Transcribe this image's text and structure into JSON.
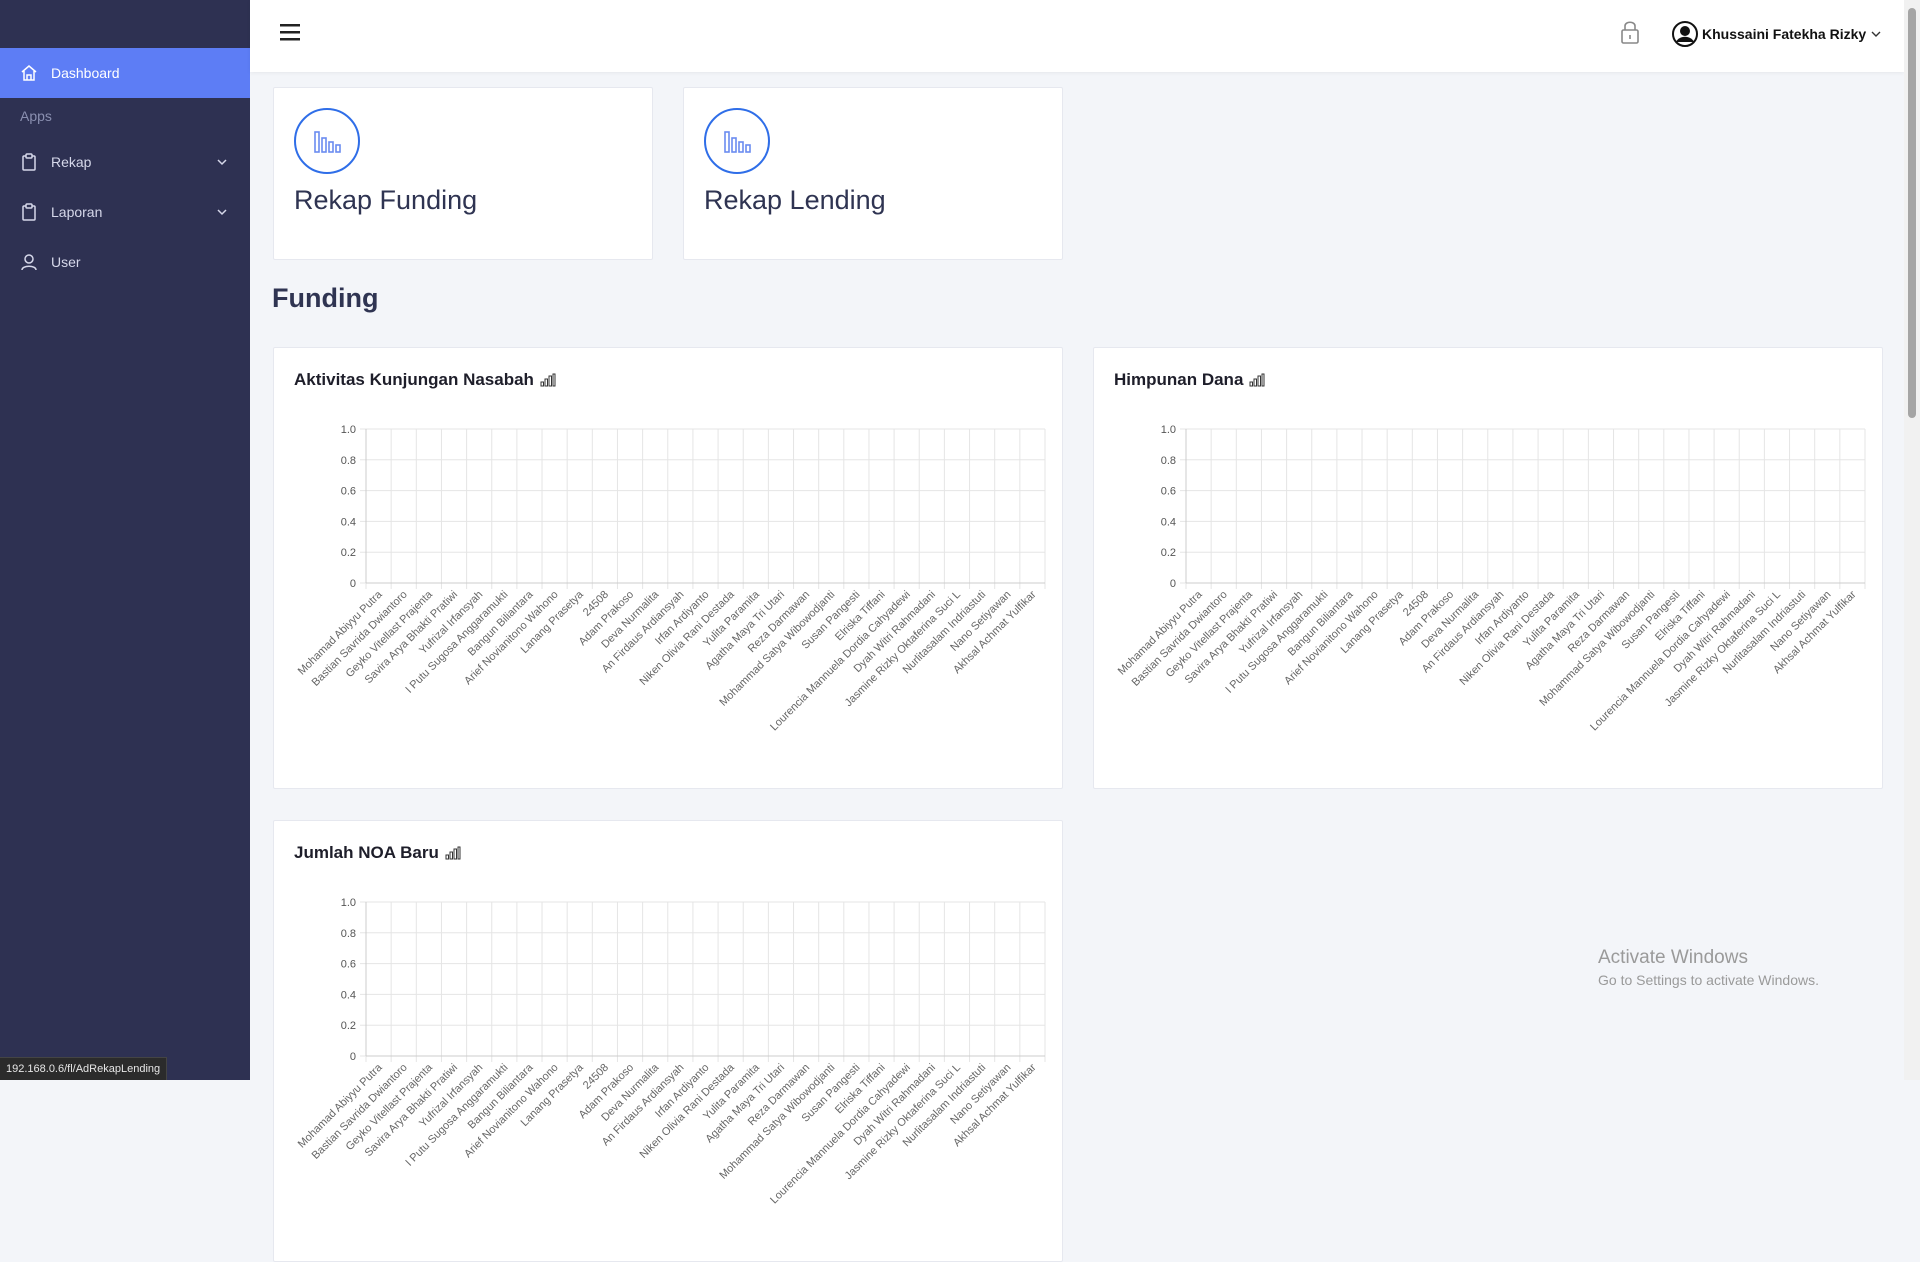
{
  "sidebar": {
    "dashboard_label": "Dashboard",
    "section_label": "Apps",
    "items": [
      {
        "label": "Rekap",
        "icon": "clipboard-icon",
        "expandable": true
      },
      {
        "label": "Laporan",
        "icon": "clipboard-icon",
        "expandable": true
      },
      {
        "label": "User",
        "icon": "user-icon",
        "expandable": false
      }
    ],
    "colors": {
      "background": "#2e3152",
      "active": "#5d7df5"
    }
  },
  "status_url": "192.168.0.6/fl/AdRekapLending",
  "topbar": {
    "user_name": "Khussaini Fatekha Rizky"
  },
  "summary_cards": [
    {
      "title": "Rekap Funding",
      "icon": "bar-chart-icon"
    },
    {
      "title": "Rekap Lending",
      "icon": "bar-chart-icon"
    }
  ],
  "section_heading": "Funding",
  "names": [
    "Mohamad Abiyyu Putra",
    "Bastian Savrida Dwiantoro",
    "Geyko Vitellast Prajenta",
    "Savira Arya Bhakti Pratiwi",
    "Yufrizal Irfansyah",
    "I Putu Sugosa Anggaramukti",
    "Bangun Biliantara",
    "Arief Novianitono Wahono",
    "Lanang Prasetya",
    "24508",
    "Adam Prakoso",
    "Deva Nurmalita",
    "An Firdaus Ardiansyah",
    "Irfan Ardiyanto",
    "Niken Olivia Rani Destada",
    "Yulita Paramita",
    "Agatha Maya Tri Utari",
    "Reza Darmawan",
    "Mohammad Satya Wibowodjanti",
    "Susan Pangesti",
    "Elriska Tiffani",
    "Lourencia Mannuela Dordia Cahyadewi",
    "Dyah Witri Rahmadani",
    "Jasmine Rizky Oktaferina Suci L",
    "Nurlitasalam Indriastuti",
    "Nano Setiyawan",
    "Akhsal Achmat Yulfikar"
  ],
  "chart_data": [
    {
      "type": "bar",
      "title": "Aktivitas Kunjungan Nasabah",
      "categories_ref": "names",
      "values": [
        0,
        0,
        0,
        0,
        0,
        0,
        0,
        0,
        0,
        0,
        0,
        0,
        0,
        0,
        0,
        0,
        0,
        0,
        0,
        0,
        0,
        0,
        0,
        0,
        0,
        0,
        0
      ],
      "yticks": [
        "1.0",
        "0.8",
        "0.6",
        "0.4",
        "0.2",
        "0"
      ],
      "ylim": [
        0,
        1
      ],
      "grid": true
    },
    {
      "type": "bar",
      "title": "Himpunan Dana",
      "categories_ref": "names",
      "values": [
        0,
        0,
        0,
        0,
        0,
        0,
        0,
        0,
        0,
        0,
        0,
        0,
        0,
        0,
        0,
        0,
        0,
        0,
        0,
        0,
        0,
        0,
        0,
        0,
        0,
        0,
        0
      ],
      "yticks": [
        "1.0",
        "0.8",
        "0.6",
        "0.4",
        "0.2",
        "0"
      ],
      "ylim": [
        0,
        1
      ],
      "grid": true
    },
    {
      "type": "bar",
      "title": "Jumlah NOA Baru",
      "categories_ref": "names",
      "values": [
        0,
        0,
        0,
        0,
        0,
        0,
        0,
        0,
        0,
        0,
        0,
        0,
        0,
        0,
        0,
        0,
        0,
        0,
        0,
        0,
        0,
        0,
        0,
        0,
        0,
        0,
        0
      ],
      "yticks": [
        "1.0",
        "0.8",
        "0.6",
        "0.4",
        "0.2",
        "0"
      ],
      "ylim": [
        0,
        1
      ],
      "grid": true
    }
  ],
  "watermark": {
    "line1": "Activate Windows",
    "line2": "Go to Settings to activate Windows."
  }
}
